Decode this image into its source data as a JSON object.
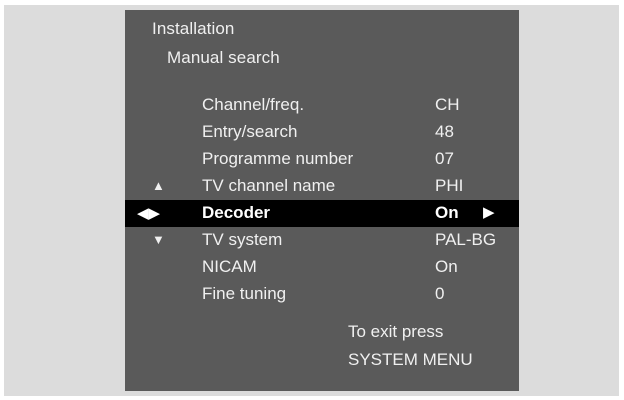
{
  "menu": {
    "title": "Installation",
    "subtitle": "Manual search"
  },
  "rows": [
    {
      "label": "Channel/freq.",
      "value": "CH"
    },
    {
      "label": "Entry/search",
      "value": "48"
    },
    {
      "label": "Programme number",
      "value": "07"
    },
    {
      "label": "TV channel name",
      "value": "PHI"
    },
    {
      "label": "Decoder",
      "value": "On",
      "selected": true
    },
    {
      "label": "TV system",
      "value": "PAL-BG"
    },
    {
      "label": "NICAM",
      "value": "On"
    },
    {
      "label": "Fine tuning",
      "value": "0"
    }
  ],
  "navigation": {
    "up_arrow": "▲",
    "left_right_arrows": "◀▶",
    "down_arrow": "▼",
    "value_arrow": "▶"
  },
  "footer": {
    "exit_line1": "To exit press",
    "exit_line2": "SYSTEM MENU"
  }
}
